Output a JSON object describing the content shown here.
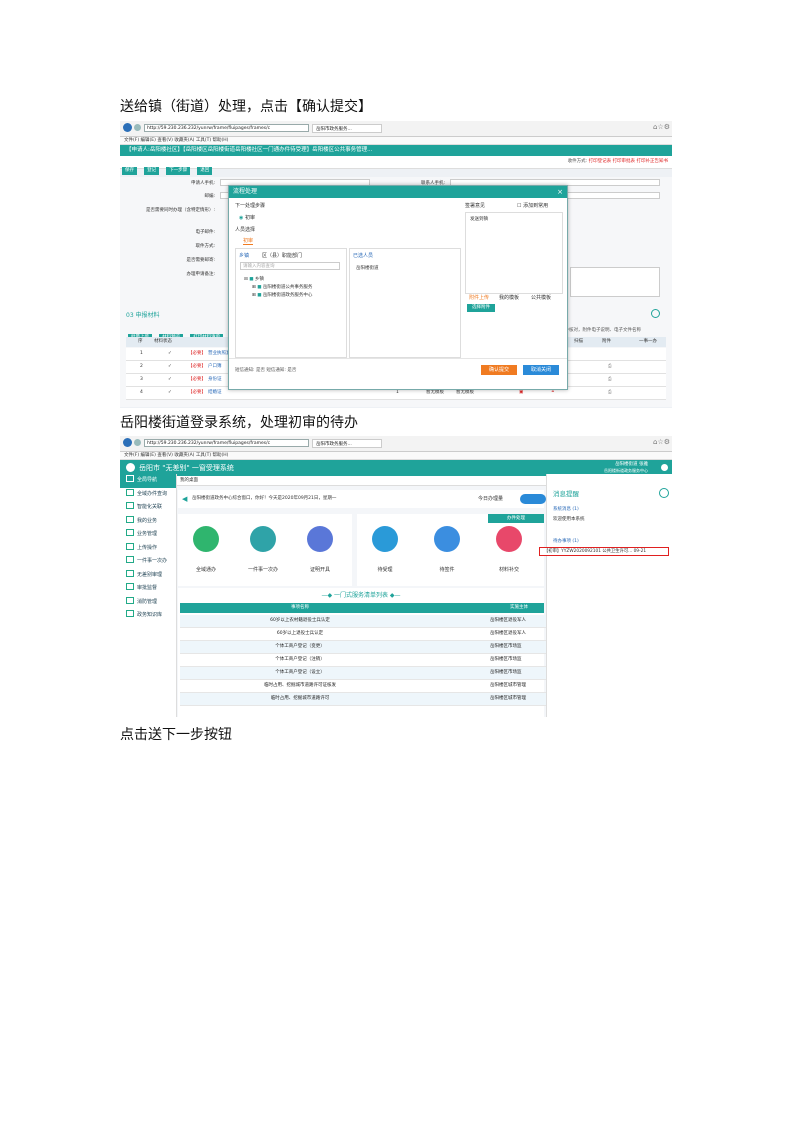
{
  "captions": {
    "step1": "送给镇（街道）处理，点击【确认提交】",
    "step2": "岳阳楼街道登录系统，处理初审的待办",
    "step3": "点击送下一步按钮"
  },
  "colors": {
    "accent": "#1fa39a",
    "highlight": "#e02020",
    "orange": "#f07b21",
    "blue": "#2a6ab8"
  },
  "shot1": {
    "ie": {
      "address": "http://59.230.236.232/yunrw/frame/fluipages/frames/c",
      "tab": "岳阳市政务服务...",
      "menu": "文件(F)  编辑(E)  查看(V)  收藏夹(A)  工具(T)  帮助(H)"
    },
    "titlebar": "【申请人:岳阳楼社区】【岳阳楼区岳阳楼街道岳阳楼社区一门通办件待受理】岳阳楼区公共事务管理...",
    "toolbar": [
      "保存",
      "登记",
      "下一步骤",
      "退回"
    ],
    "right_links": [
      "收件方式:",
      "打印登记表",
      "打印审批表",
      "打印补正告知书"
    ],
    "form_labels": [
      "申请人手机:",
      "邮编:",
      "是否需要同时办理（含特定情形）:",
      "电子邮件:",
      "取件方式:",
      "是否需要邮寄:",
      "办理申请备注:"
    ],
    "form_labels_right": [
      "联系人手机:"
    ],
    "dialog": {
      "title": "流程处理",
      "next_step_label": "下一处理步骤",
      "step_option": "初审",
      "person_label": "人员选择",
      "person_tab": "初审",
      "tree_tabs": [
        "乡镇",
        "区（县）职能部门"
      ],
      "search_placeholder": "请输入内容查询",
      "tree_nodes": [
        "乡镇",
        "岳阳楼街道公共事务服务",
        "岳阳楼街道政务服务中心"
      ],
      "selected_label": "已选人员",
      "selected_item": "岳阳楼街道",
      "opinion_label": "签署意见",
      "add_common": "添加到常用",
      "opinion_text": "发送到镇",
      "opinion_tabs": [
        "附件上传",
        "我的模板",
        "公共模板"
      ],
      "attach_btn": "选择附件",
      "footer_left": "短信通知:  是否    短信通知:  是否",
      "confirm": "确认提交",
      "cancel": "取消关闭"
    },
    "materials": {
      "heading": "03 申报材料",
      "toolbar": [
        "批量上传",
        "材料预览",
        "打印材料清单"
      ],
      "columns": [
        "序",
        "材料状态",
        "材料名称",
        "份数",
        "纸质",
        "电子",
        "操作",
        "扫描",
        "附件",
        "一事一办"
      ],
      "rows": [
        {
          "no": "1",
          "tag": "【必要】",
          "name": "营业执照复印件",
          "count": "",
          "paper": "",
          "elec": ""
        },
        {
          "no": "2",
          "tag": "【必要】",
          "name": "户口簿",
          "count": "1",
          "paper": "暂无模板",
          "elec": "暂无模板"
        },
        {
          "no": "3",
          "tag": "【必要】",
          "name": "身份证",
          "count": "1",
          "paper": "暂无模板",
          "elec": "暂无模板"
        },
        {
          "no": "4",
          "tag": "【必要】",
          "name": "结婚证",
          "count": "1",
          "paper": "暂无模板",
          "elec": "暂无模板"
        }
      ],
      "note": "原件核对，附件电子说明、电子文件名称"
    }
  },
  "shot2": {
    "ie": {
      "address": "http://59.230.236.232/yunrw/frame/fluipages/frames/c",
      "tab": "岳阳市政务服务...",
      "menu": "文件(F)  编辑(E)  查看(V)  收藏夹(A)  工具(T)  帮助(H)"
    },
    "app_title": "岳阳市 \"无差别\" 一窗受理系统",
    "user": "岳阳楼街道  张雅",
    "user_sub": "岳阳楼街道政务服务中心",
    "tab": "我的桌面",
    "sidebar": [
      "全局导航",
      "全域办件查询",
      "智能化关联",
      "我的业务",
      "业务管理",
      "上传操作",
      "一件事一次办",
      "无差别审理",
      "审批监督",
      "消防管理",
      "政务知识库"
    ],
    "welcome": "岳阳楼街道政务中心综合窗口，你好！今天是2020年09月21日，星期一",
    "today": "今日办理量",
    "process_tag": "办件处理",
    "circles_left": [
      "全域通办",
      "一件事一次办",
      "证明开具"
    ],
    "circles_right": [
      "待受理",
      "待签件",
      "材料补交"
    ],
    "list_title": "一门式服务清单列表",
    "list_cols": [
      "事项名称",
      "实施主体"
    ],
    "list_rows": [
      {
        "name": "60岁以上农村籍退役士兵认定",
        "org": "岳阳楼区退役军人"
      },
      {
        "name": "60岁以上退役士兵认定",
        "org": "岳阳楼区退役军人"
      },
      {
        "name": "个体工商户登记（变更）",
        "org": "岳阳楼区市场监"
      },
      {
        "name": "个体工商户登记（注销）",
        "org": "岳阳楼区市场监"
      },
      {
        "name": "个体工商户登记（设立）",
        "org": "岳阳楼区市场监"
      },
      {
        "name": "临时占用、挖掘城市道路许可证核发",
        "org": "岳阳楼区城市管理"
      },
      {
        "name": "临时占用、挖掘城市道路许可",
        "org": "岳阳楼区城市管理"
      }
    ],
    "messages": {
      "title": "消息提醒",
      "system_label": "系统消息 (1)",
      "system_item": "欢迎使用本系统",
      "todo_label": "待办事项 (1)",
      "todo_item": "【初审】YYZW2020092101 公共卫生许可... 09-21"
    }
  }
}
